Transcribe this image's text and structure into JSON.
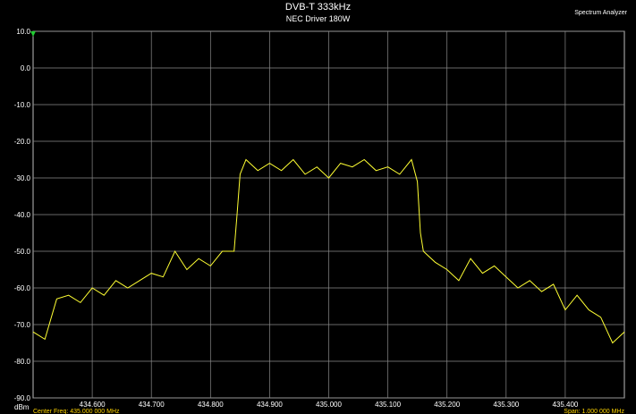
{
  "chart_data": {
    "type": "line",
    "title": "DVB-T 333kHz",
    "subtitle": "NEC Driver 180W",
    "instrument": "Spectrum Analyzer",
    "ylabel": "dBm",
    "xlim": [
      434.5,
      435.5
    ],
    "ylim": [
      -90,
      10
    ],
    "x_ticks": [
      "434.600",
      "434.700",
      "434.800",
      "434.900",
      "435.000",
      "435.100",
      "435.200",
      "435.300",
      "435.400"
    ],
    "y_ticks": [
      "10.0",
      "0.0",
      "-10.0",
      "-20.0",
      "-30.0",
      "-40.0",
      "-50.0",
      "-60.0",
      "-70.0",
      "-80.0",
      "-90.0"
    ],
    "footer_left": "Center Freq: 435.000 000 MHz",
    "footer_right": "Span: 1.000 000 MHz",
    "grid": true,
    "line_color": "#ffff33",
    "series": [
      {
        "x": [
          434.5,
          434.52,
          434.54,
          434.56,
          434.58,
          434.6,
          434.62,
          434.64,
          434.66,
          434.68,
          434.7,
          434.72,
          434.74,
          434.76,
          434.78,
          434.8,
          434.82,
          434.84,
          434.845,
          434.85,
          434.86,
          434.88,
          434.9,
          434.92,
          434.94,
          434.96,
          434.98,
          435.0,
          435.02,
          435.04,
          435.06,
          435.08,
          435.1,
          435.12,
          435.14,
          435.15,
          435.155,
          435.16,
          435.18,
          435.2,
          435.22,
          435.24,
          435.26,
          435.28,
          435.3,
          435.32,
          435.34,
          435.36,
          435.38,
          435.4,
          435.42,
          435.44,
          435.46,
          435.48,
          435.5
        ],
        "y": [
          -72,
          -74,
          -63,
          -62,
          -64,
          -60,
          -62,
          -58,
          -60,
          -58,
          -56,
          -57,
          -50,
          -55,
          -52,
          -54,
          -50,
          -50,
          -40,
          -29,
          -25,
          -28,
          -26,
          -28,
          -25,
          -29,
          -27,
          -30,
          -26,
          -27,
          -25,
          -28,
          -27,
          -29,
          -25,
          -31,
          -45,
          -50,
          -53,
          -55,
          -58,
          -52,
          -56,
          -54,
          -57,
          -60,
          -58,
          -61,
          -59,
          -66,
          -62,
          -66,
          -68,
          -75,
          -72
        ]
      }
    ]
  }
}
